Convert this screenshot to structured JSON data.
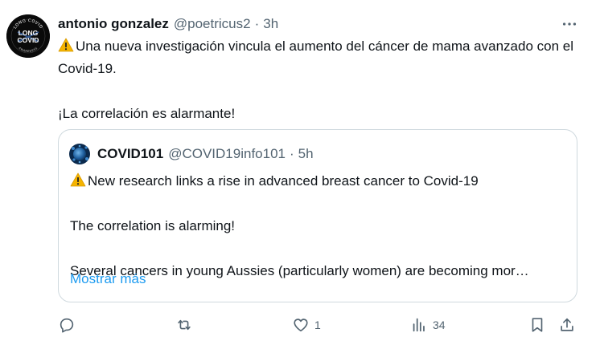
{
  "tweet": {
    "author_name": "antonio gonzalez",
    "author_handle": "@poetricus2",
    "separator": "·",
    "time": "3h",
    "avatar": {
      "icon": "long-covid-badge",
      "arc_text": "LONG COVID",
      "line1": "LONG",
      "line2": "COVID",
      "arc_text_bottom": "AWARENESS"
    },
    "text_line1": "Una nueva investigación vincula el aumento del cáncer de mama avanzado con el Covid-19.",
    "text_line2": "¡La correlación es alarmante!",
    "warning_icon": "warning-emoji"
  },
  "quote": {
    "author_name": "COVID101",
    "author_handle": "@COVID19info101",
    "separator": "·",
    "time": "5h",
    "avatar_icon": "virus-avatar",
    "text_line1": "New research links a rise in advanced breast cancer to Covid-19",
    "text_line2": "The correlation is alarming!",
    "text_line3": "Several cancers in young Aussies (particularly women) are becoming mor…",
    "show_more": "Mostrar más"
  },
  "actions": {
    "reply": {
      "icon": "reply-icon",
      "count": ""
    },
    "retweet": {
      "icon": "retweet-icon",
      "count": ""
    },
    "like": {
      "icon": "heart-icon",
      "count": "1"
    },
    "views": {
      "icon": "views-icon",
      "count": "34"
    },
    "bookmark": {
      "icon": "bookmark-icon"
    },
    "share": {
      "icon": "share-icon"
    }
  },
  "colors": {
    "text": "#0f1419",
    "secondary": "#536471",
    "link": "#1d9bf0",
    "border": "#cfd9de"
  }
}
